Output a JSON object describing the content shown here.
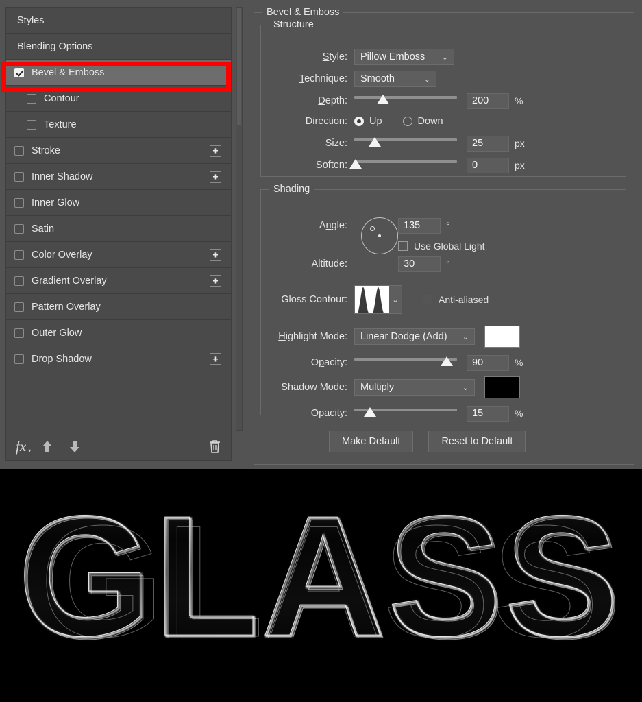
{
  "sidebar": {
    "items": [
      {
        "label": "Styles",
        "type": "header",
        "checkbox": false,
        "checked": false,
        "plus": false,
        "selected": false,
        "indent": false
      },
      {
        "label": "Blending Options",
        "type": "header",
        "checkbox": false,
        "checked": false,
        "plus": false,
        "selected": false,
        "indent": false
      },
      {
        "label": "Bevel & Emboss",
        "type": "effect",
        "checkbox": true,
        "checked": true,
        "plus": false,
        "selected": true,
        "indent": false
      },
      {
        "label": "Contour",
        "type": "sub",
        "checkbox": true,
        "checked": false,
        "plus": false,
        "selected": false,
        "indent": true
      },
      {
        "label": "Texture",
        "type": "sub",
        "checkbox": true,
        "checked": false,
        "plus": false,
        "selected": false,
        "indent": true
      },
      {
        "label": "Stroke",
        "type": "effect",
        "checkbox": true,
        "checked": false,
        "plus": true,
        "selected": false,
        "indent": false
      },
      {
        "label": "Inner Shadow",
        "type": "effect",
        "checkbox": true,
        "checked": false,
        "plus": true,
        "selected": false,
        "indent": false
      },
      {
        "label": "Inner Glow",
        "type": "effect",
        "checkbox": true,
        "checked": false,
        "plus": false,
        "selected": false,
        "indent": false
      },
      {
        "label": "Satin",
        "type": "effect",
        "checkbox": true,
        "checked": false,
        "plus": false,
        "selected": false,
        "indent": false
      },
      {
        "label": "Color Overlay",
        "type": "effect",
        "checkbox": true,
        "checked": false,
        "plus": true,
        "selected": false,
        "indent": false
      },
      {
        "label": "Gradient Overlay",
        "type": "effect",
        "checkbox": true,
        "checked": false,
        "plus": true,
        "selected": false,
        "indent": false
      },
      {
        "label": "Pattern Overlay",
        "type": "effect",
        "checkbox": true,
        "checked": false,
        "plus": false,
        "selected": false,
        "indent": false
      },
      {
        "label": "Outer Glow",
        "type": "effect",
        "checkbox": true,
        "checked": false,
        "plus": false,
        "selected": false,
        "indent": false
      },
      {
        "label": "Drop Shadow",
        "type": "effect",
        "checkbox": true,
        "checked": false,
        "plus": true,
        "selected": false,
        "indent": false
      }
    ],
    "plus_symbol": "+",
    "toolbar": {
      "fx_label": "fx",
      "fx_caret": "▾",
      "move_up_icon": "arrow-up",
      "move_down_icon": "arrow-down",
      "delete_icon": "trash"
    }
  },
  "panel": {
    "title": "Bevel & Emboss",
    "structure": {
      "legend": "Structure",
      "style": {
        "label_pre": "S",
        "label_key": "t",
        "label_post": "yle:",
        "label": "Style:",
        "value": "Pillow Emboss"
      },
      "technique": {
        "label": "Technique:",
        "value": "Smooth"
      },
      "depth": {
        "label": "Depth:",
        "value": "200",
        "unit": "%",
        "percent": 28
      },
      "direction": {
        "label": "Direction:",
        "up": "Up",
        "down": "Down",
        "selected": "Up"
      },
      "size": {
        "label": "Size:",
        "value": "25",
        "unit": "px",
        "percent": 20
      },
      "soften": {
        "label": "Soften:",
        "value": "0",
        "unit": "px",
        "percent": 1
      }
    },
    "shading": {
      "legend": "Shading",
      "angle": {
        "label": "Angle:",
        "value": "135",
        "unit": "°"
      },
      "use_global_light": {
        "label": "Use Global Light",
        "checked": false
      },
      "altitude": {
        "label": "Altitude:",
        "value": "30",
        "unit": "°"
      },
      "gloss_contour": {
        "label": "Gloss Contour:",
        "preset": "ring-double"
      },
      "anti_aliased": {
        "label": "Anti-aliased",
        "checked": false
      },
      "highlight_mode": {
        "label": "Highlight Mode:",
        "value": "Linear Dodge (Add)",
        "color": "#ffffff"
      },
      "highlight_opacity": {
        "label": "Opacity:",
        "value": "90",
        "unit": "%",
        "percent": 90
      },
      "shadow_mode": {
        "label": "Shadow Mode:",
        "value": "Multiply",
        "color": "#000000"
      },
      "shadow_opacity": {
        "label": "Opacity:",
        "value": "15",
        "unit": "%",
        "percent": 15
      }
    },
    "buttons": {
      "make_default": "Make Default",
      "reset_to_default": "Reset to Default"
    },
    "chevron": "⌄"
  },
  "annotation": {
    "highlight_color": "#fe0000",
    "target": "Bevel & Emboss"
  },
  "preview": {
    "text": "GLASS",
    "background": "#000000",
    "effect": "glass-bevel-emboss"
  }
}
